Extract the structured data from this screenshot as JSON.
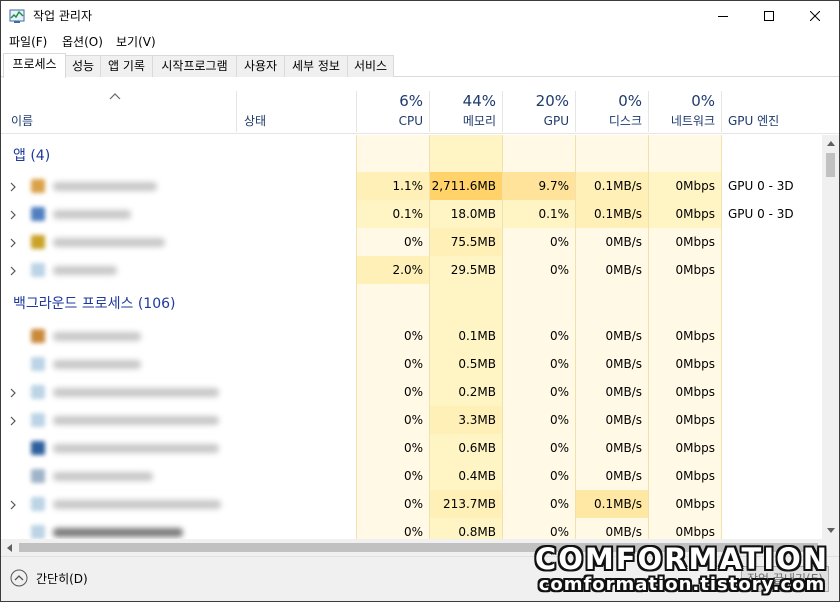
{
  "window": {
    "title": "작업 관리자",
    "controls": {
      "minimize_icon": "minimize-icon",
      "maximize_icon": "maximize-icon",
      "close_icon": "close-icon"
    }
  },
  "menu": [
    "파일(F)",
    "옵션(O)",
    "보기(V)"
  ],
  "tabs": [
    "프로세스",
    "성능",
    "앱 기록",
    "시작프로그램",
    "사용자",
    "세부 정보",
    "서비스"
  ],
  "active_tab": "프로세스",
  "columns": {
    "name": "이름",
    "status": "상태",
    "cpu": {
      "pct": "6%",
      "label": "CPU"
    },
    "memory": {
      "pct": "44%",
      "label": "메모리"
    },
    "gpu": {
      "pct": "20%",
      "label": "GPU"
    },
    "disk": {
      "pct": "0%",
      "label": "디스크"
    },
    "network": {
      "pct": "0%",
      "label": "네트워크"
    },
    "gpu_engine": "GPU 엔진"
  },
  "groups": {
    "apps": "앱 (4)",
    "background": "백그라운드 프로세스 (106)"
  },
  "apps": [
    {
      "cpu": "1.1%",
      "memory": "2,711.6MB",
      "gpu": "9.7%",
      "disk": "0.1MB/s",
      "network": "0Mbps",
      "gpu_engine": "GPU 0 - 3D"
    },
    {
      "cpu": "0.1%",
      "memory": "18.0MB",
      "gpu": "0.1%",
      "disk": "0.1MB/s",
      "network": "0Mbps",
      "gpu_engine": "GPU 0 - 3D"
    },
    {
      "cpu": "0%",
      "memory": "75.5MB",
      "gpu": "0%",
      "disk": "0MB/s",
      "network": "0Mbps",
      "gpu_engine": ""
    },
    {
      "cpu": "2.0%",
      "memory": "29.5MB",
      "gpu": "0%",
      "disk": "0MB/s",
      "network": "0Mbps",
      "gpu_engine": ""
    }
  ],
  "background": [
    {
      "cpu": "0%",
      "memory": "0.1MB",
      "gpu": "0%",
      "disk": "0MB/s",
      "network": "0Mbps"
    },
    {
      "cpu": "0%",
      "memory": "0.5MB",
      "gpu": "0%",
      "disk": "0MB/s",
      "network": "0Mbps"
    },
    {
      "cpu": "0%",
      "memory": "0.2MB",
      "gpu": "0%",
      "disk": "0MB/s",
      "network": "0Mbps"
    },
    {
      "cpu": "0%",
      "memory": "3.3MB",
      "gpu": "0%",
      "disk": "0MB/s",
      "network": "0Mbps"
    },
    {
      "cpu": "0%",
      "memory": "0.6MB",
      "gpu": "0%",
      "disk": "0MB/s",
      "network": "0Mbps"
    },
    {
      "cpu": "0%",
      "memory": "0.4MB",
      "gpu": "0%",
      "disk": "0MB/s",
      "network": "0Mbps"
    },
    {
      "cpu": "0%",
      "memory": "213.7MB",
      "gpu": "0%",
      "disk": "0.1MB/s",
      "network": "0Mbps"
    },
    {
      "cpu": "0%",
      "memory": "0.8MB",
      "gpu": "0%",
      "disk": "0MB/s",
      "network": "0Mbps"
    }
  ],
  "footer": {
    "fewer_details": "간단히(D)",
    "end_task": "작업 끝내기(E)"
  },
  "watermark": {
    "brand": "COMFORMATION",
    "url": "comformation.tistory.com"
  },
  "colors": {
    "header_text": "#1e3a6e",
    "group_text": "#1e3a9e",
    "heat_light": "#fff4c4",
    "heat_medium": "#ffe8a3",
    "heat_strong": "#ffd26a",
    "heat_column": "#fff9e5"
  }
}
